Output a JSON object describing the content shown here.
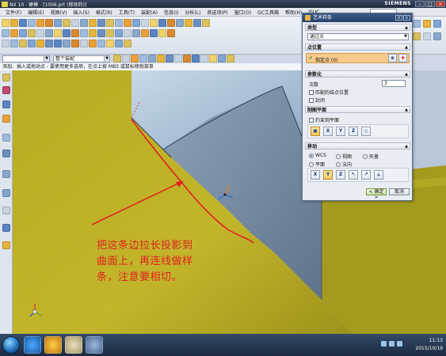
{
  "window": {
    "title": "NX 10 - 建模 - [1006.prt  (修改的)]",
    "brand": "SIEMENS",
    "controls": [
      "–",
      "□",
      "×"
    ]
  },
  "menu": [
    "文件(F)",
    "编辑(E)",
    "视图(V)",
    "插入(S)",
    "格式(R)",
    "工具(T)",
    "装配(A)",
    "信息(I)",
    "分析(L)",
    "首选项(P)",
    "窗口(O)",
    "GC工具箱",
    "帮助(H)",
    "JSUC"
  ],
  "toolbar": {
    "selection_filter": "整个装配",
    "icon_names": [
      "new-icon",
      "open-icon",
      "save-icon",
      "sketch-icon",
      "extrude-icon",
      "revolve-icon",
      "hole-icon",
      "blend-icon",
      "chamfer-icon",
      "trim-icon",
      "sweep-icon",
      "mesh-icon"
    ]
  },
  "status_line": "添加、插入或拖动点 - 要使用更多选项，在点上按 MB3 或鼠标移就菜单",
  "annotation": {
    "lines": [
      "把这条边拉长投影到",
      "曲面上，再连线做样",
      "条，注意要相切。"
    ],
    "color": "#e02020"
  },
  "dialog": {
    "title": "艺术样条",
    "type_section": {
      "label": "类型",
      "value": "通过点"
    },
    "points_section": {
      "label": "点位置",
      "value": "指定点 (0)"
    },
    "param_section": {
      "label": "参数化",
      "degree_label": "次数",
      "degree_value": "3",
      "options": [
        "匹配的结点位置",
        "封闭"
      ]
    },
    "plane_section": {
      "label": "制图平面",
      "constrain_label": "约束到平面"
    },
    "move_section": {
      "label": "移动",
      "radio_options": [
        "WCS",
        "视图",
        "矢量",
        "平面",
        "法向"
      ],
      "selected": "WCS",
      "axis_buttons": [
        "X",
        "Y",
        "Z",
        "↖",
        "↗",
        "⟂"
      ]
    },
    "ok_label": "< 确定 >",
    "cancel_label": "取消"
  },
  "taskbar": {
    "time": "11:13",
    "date": "2015/10/19"
  },
  "colors": {
    "surface_yellow": "#b8ac20",
    "surface_blue": "#a8c0d8",
    "surface_slate": "#7c90a6",
    "curve_red": "#e02020",
    "dialog_title": "#23406a"
  }
}
